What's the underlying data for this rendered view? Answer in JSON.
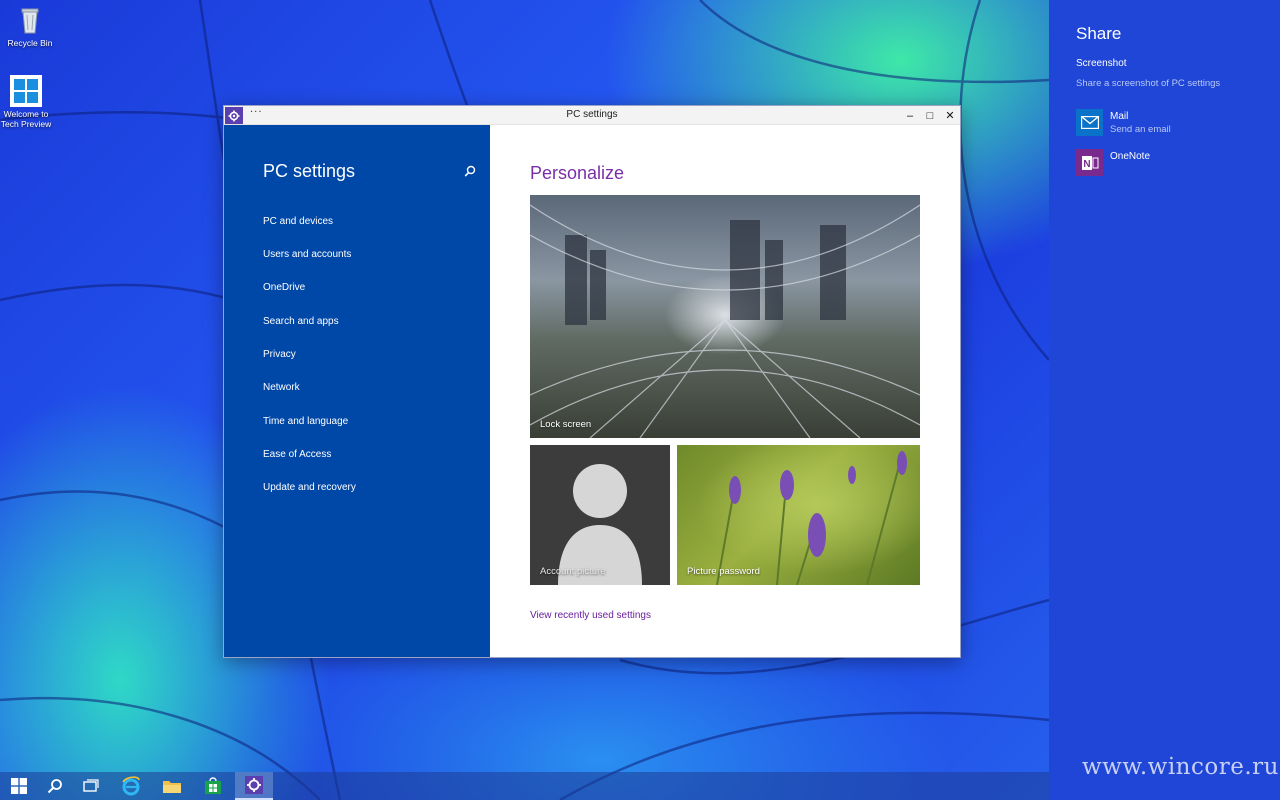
{
  "desktop": {
    "icons": [
      {
        "label": "Recycle Bin"
      },
      {
        "label_line1": "Welcome to",
        "label_line2": "Tech Preview"
      }
    ]
  },
  "window": {
    "title": "PC settings",
    "menu_dots": "···",
    "controls": {
      "minimize": "–",
      "maximize": "□",
      "close": "✕"
    },
    "sidebar": {
      "heading": "PC settings",
      "items": [
        {
          "label": "PC and devices"
        },
        {
          "label": "Users and accounts"
        },
        {
          "label": "OneDrive"
        },
        {
          "label": "Search and apps"
        },
        {
          "label": "Privacy"
        },
        {
          "label": "Network"
        },
        {
          "label": "Time and language"
        },
        {
          "label": "Ease of Access"
        },
        {
          "label": "Update and recovery"
        }
      ]
    },
    "content": {
      "title": "Personalize",
      "tiles": [
        {
          "label": "Lock screen"
        },
        {
          "label": "Account picture"
        },
        {
          "label": "Picture password"
        }
      ],
      "recent_link": "View recently used settings"
    }
  },
  "share_charm": {
    "title": "Share",
    "subtitle": "Screenshot",
    "description": "Share a screenshot of PC settings",
    "targets": [
      {
        "name": "Mail",
        "desc": "Send an email",
        "color": "#0a72c8"
      },
      {
        "name": "OneNote",
        "desc": "",
        "color": "#7a2a8c"
      }
    ]
  },
  "watermark": "www.wincore.ru",
  "colors": {
    "sidebar": "#0048a8",
    "accent_purple": "#7a2ea8",
    "charm_bg": "#1f46d6"
  }
}
